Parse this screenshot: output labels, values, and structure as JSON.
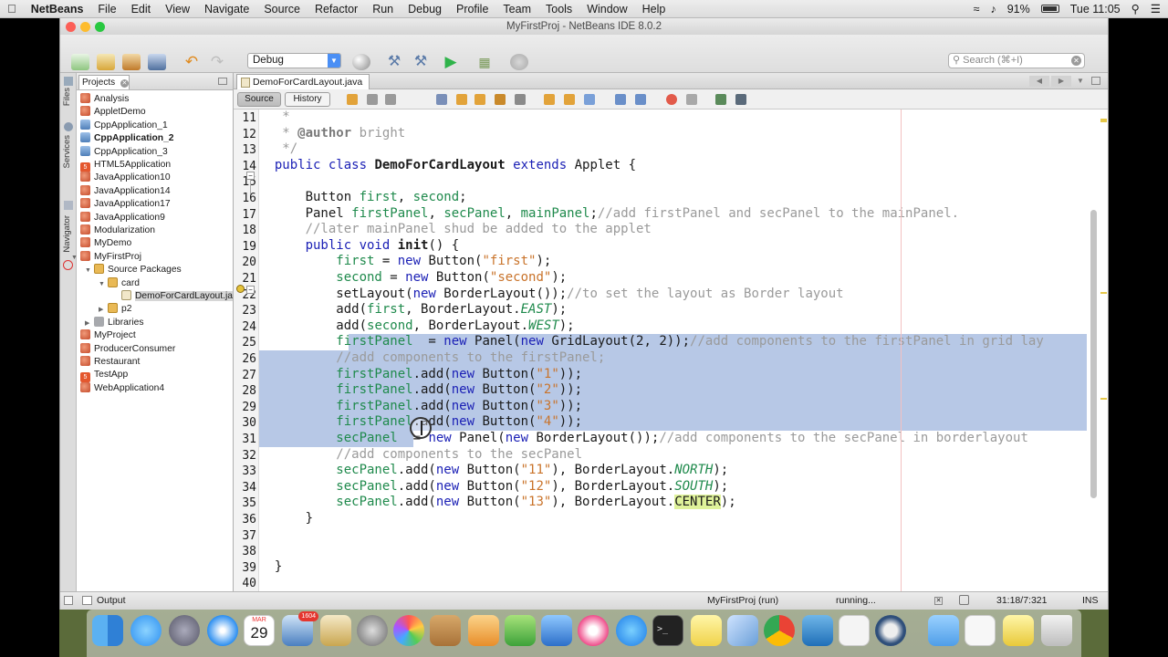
{
  "menubar": {
    "app": "NetBeans",
    "items": [
      "File",
      "Edit",
      "View",
      "Navigate",
      "Source",
      "Refactor",
      "Run",
      "Debug",
      "Profile",
      "Team",
      "Tools",
      "Window",
      "Help"
    ],
    "battery": "91%",
    "clock": "Tue 11:05"
  },
  "window": {
    "title": "MyFirstProj - NetBeans IDE 8.0.2"
  },
  "toolbar": {
    "config": "Debug",
    "search_placeholder": "Search (⌘+I)"
  },
  "left_strip": {
    "labels": [
      "Files",
      "Services",
      "Navigator"
    ]
  },
  "projects_panel": {
    "tab": "Projects",
    "items": [
      {
        "label": "Analysis",
        "icon": "cup",
        "indent": 0
      },
      {
        "label": "AppletDemo",
        "icon": "cup",
        "indent": 0
      },
      {
        "label": "CppApplication_1",
        "icon": "cpp",
        "indent": 0
      },
      {
        "label": "CppApplication_2",
        "icon": "cpp",
        "indent": 0,
        "bold": true
      },
      {
        "label": "CppApplication_3",
        "icon": "cpp",
        "indent": 0
      },
      {
        "label": "HTML5Application",
        "icon": "html5",
        "indent": 0
      },
      {
        "label": "JavaApplication10",
        "icon": "cup",
        "indent": 0
      },
      {
        "label": "JavaApplication14",
        "icon": "cup",
        "indent": 0
      },
      {
        "label": "JavaApplication17",
        "icon": "cup",
        "indent": 0
      },
      {
        "label": "JavaApplication9",
        "icon": "cup",
        "indent": 0
      },
      {
        "label": "Modularization",
        "icon": "cup",
        "indent": 0
      },
      {
        "label": "MyDemo",
        "icon": "cup",
        "indent": 0
      },
      {
        "label": "MyFirstProj",
        "icon": "cup",
        "indent": 0,
        "twisty": "down"
      },
      {
        "label": "Source Packages",
        "icon": "pkg",
        "indent": 1,
        "twisty": "down"
      },
      {
        "label": "card",
        "icon": "pkg",
        "indent": 2,
        "twisty": "down"
      },
      {
        "label": "DemoForCardLayout.ja",
        "icon": "jfile",
        "indent": 3,
        "selected": true
      },
      {
        "label": "p2",
        "icon": "pkg",
        "indent": 2,
        "twisty": "right"
      },
      {
        "label": "Libraries",
        "icon": "lib",
        "indent": 1,
        "twisty": "right"
      },
      {
        "label": "MyProject",
        "icon": "cup",
        "indent": 0
      },
      {
        "label": "ProducerConsumer",
        "icon": "cup",
        "indent": 0
      },
      {
        "label": "Restaurant",
        "icon": "cup",
        "indent": 0
      },
      {
        "label": "TestApp",
        "icon": "html5",
        "indent": 0
      },
      {
        "label": "WebApplication4",
        "icon": "cup",
        "indent": 0
      }
    ]
  },
  "editor": {
    "tab": "DemoForCardLayout.java",
    "source_button": "Source",
    "history_button": "History",
    "line_numbers": [
      "11",
      "12",
      "13",
      "14",
      "15",
      "16",
      "17",
      "18",
      "19",
      "20",
      "21",
      "22",
      "23",
      "24",
      "25",
      "26",
      "27",
      "28",
      "29",
      "30",
      "31",
      "32",
      "33",
      "34",
      "35",
      "36",
      "37",
      "38",
      "39",
      "40"
    ],
    "lines": [
      [
        [
          "cm",
          "   *"
        ]
      ],
      [
        [
          "cm",
          "   * "
        ],
        [
          "au",
          "@author"
        ],
        [
          "cm",
          " bright"
        ]
      ],
      [
        [
          "cm",
          "   */"
        ]
      ],
      [
        [
          "kw",
          "  public class "
        ],
        [
          "cb",
          "DemoForCardLayout"
        ],
        [
          "kw",
          " extends "
        ],
        [
          "",
          "Applet {"
        ]
      ],
      [
        [
          "",
          ""
        ]
      ],
      [
        [
          "",
          "      Button "
        ],
        [
          "id",
          "first"
        ],
        [
          "",
          ", "
        ],
        [
          "id",
          "second"
        ],
        [
          "",
          ";"
        ]
      ],
      [
        [
          "",
          "      Panel "
        ],
        [
          "id",
          "firstPanel"
        ],
        [
          "",
          ", "
        ],
        [
          "id",
          "secPanel"
        ],
        [
          "",
          ", "
        ],
        [
          "id",
          "mainPanel"
        ],
        [
          "",
          ";"
        ],
        [
          "cm",
          "//add firstPanel and secPanel to the mainPanel."
        ]
      ],
      [
        [
          "cm",
          "      //later mainPanel shud be added to the applet"
        ]
      ],
      [
        [
          "kw",
          "      public void "
        ],
        [
          "cb",
          "init"
        ],
        [
          "",
          "() {"
        ]
      ],
      [
        [
          "id",
          "          first"
        ],
        [
          "",
          " = "
        ],
        [
          "kw",
          "new "
        ],
        [
          "",
          "Button("
        ],
        [
          "st",
          "\"first\""
        ],
        [
          "",
          ");"
        ]
      ],
      [
        [
          "id",
          "          second"
        ],
        [
          "",
          " = "
        ],
        [
          "kw",
          "new "
        ],
        [
          "",
          "Button("
        ],
        [
          "st",
          "\"second\""
        ],
        [
          "",
          ");"
        ]
      ],
      [
        [
          "",
          "          setLayout("
        ],
        [
          "kw",
          "new "
        ],
        [
          "",
          "BorderLayout());"
        ],
        [
          "cm",
          "//to set the layout as Border layout"
        ]
      ],
      [
        [
          "",
          "          add("
        ],
        [
          "id",
          "first"
        ],
        [
          "",
          ", BorderLayout."
        ],
        [
          "it",
          "EAST"
        ],
        [
          "",
          ");"
        ]
      ],
      [
        [
          "",
          "          add("
        ],
        [
          "id",
          "second"
        ],
        [
          "",
          ", BorderLayout."
        ],
        [
          "it",
          "WEST"
        ],
        [
          "",
          ");"
        ]
      ],
      [
        [
          "id",
          "          firstPanel"
        ],
        [
          "",
          "  = "
        ],
        [
          "kw",
          "new "
        ],
        [
          "",
          "Panel("
        ],
        [
          "kw",
          "new "
        ],
        [
          "",
          "GridLayout(2, 2));"
        ],
        [
          "cm",
          "//add components to the firstPanel in grid lay"
        ]
      ],
      [
        [
          "cm",
          "          //add components to the firstPanel;"
        ]
      ],
      [
        [
          "id",
          "          firstPanel"
        ],
        [
          "",
          ".add("
        ],
        [
          "kw",
          "new "
        ],
        [
          "",
          "Button("
        ],
        [
          "st",
          "\"1\""
        ],
        [
          "",
          "));"
        ]
      ],
      [
        [
          "id",
          "          firstPanel"
        ],
        [
          "",
          ".add("
        ],
        [
          "kw",
          "new "
        ],
        [
          "",
          "Button("
        ],
        [
          "st",
          "\"2\""
        ],
        [
          "",
          "));"
        ]
      ],
      [
        [
          "id",
          "          firstPanel"
        ],
        [
          "",
          ".add("
        ],
        [
          "kw",
          "new "
        ],
        [
          "",
          "Button("
        ],
        [
          "st",
          "\"3\""
        ],
        [
          "",
          "));"
        ]
      ],
      [
        [
          "id",
          "          firstPanel"
        ],
        [
          "",
          ".add("
        ],
        [
          "kw",
          "new "
        ],
        [
          "",
          "Button("
        ],
        [
          "st",
          "\"4\""
        ],
        [
          "",
          "));"
        ]
      ],
      [
        [
          "id",
          "          secPanel"
        ],
        [
          "",
          "  = "
        ],
        [
          "kw",
          "new "
        ],
        [
          "",
          "Panel("
        ],
        [
          "kw",
          "new "
        ],
        [
          "",
          "BorderLayout());"
        ],
        [
          "cm",
          "//add components to the secPanel in borderlayout"
        ]
      ],
      [
        [
          "cm",
          "          //add components to the secPanel"
        ]
      ],
      [
        [
          "id",
          "          secPanel"
        ],
        [
          "",
          ".add("
        ],
        [
          "kw",
          "new "
        ],
        [
          "",
          "Button("
        ],
        [
          "st",
          "\"11\""
        ],
        [
          "",
          "), BorderLayout."
        ],
        [
          "it",
          "NORTH"
        ],
        [
          "",
          ");"
        ]
      ],
      [
        [
          "id",
          "          secPanel"
        ],
        [
          "",
          ".add("
        ],
        [
          "kw",
          "new "
        ],
        [
          "",
          "Button("
        ],
        [
          "st",
          "\"12\""
        ],
        [
          "",
          "), BorderLayout."
        ],
        [
          "it",
          "SOUTH"
        ],
        [
          "",
          ");"
        ]
      ],
      [
        [
          "id",
          "          secPanel"
        ],
        [
          "",
          ".add("
        ],
        [
          "kw",
          "new "
        ],
        [
          "",
          "Button("
        ],
        [
          "st",
          "\"13\""
        ],
        [
          "",
          "), BorderLayout."
        ],
        [
          "hl",
          "CENTER"
        ],
        [
          "",
          ");"
        ]
      ],
      [
        [
          "",
          "      }"
        ]
      ],
      [
        [
          "",
          ""
        ]
      ],
      [
        [
          "",
          ""
        ]
      ],
      [
        [
          "",
          "  }"
        ]
      ],
      [
        [
          "",
          ""
        ]
      ]
    ]
  },
  "statusbar": {
    "output_tab": "Output",
    "project": "MyFirstProj (run)",
    "progress": "running...",
    "position": "31:18/7:321",
    "mode": "INS"
  },
  "dock": {
    "calendar_day": "29",
    "calendar_month": "MAR",
    "badge": "1604"
  }
}
